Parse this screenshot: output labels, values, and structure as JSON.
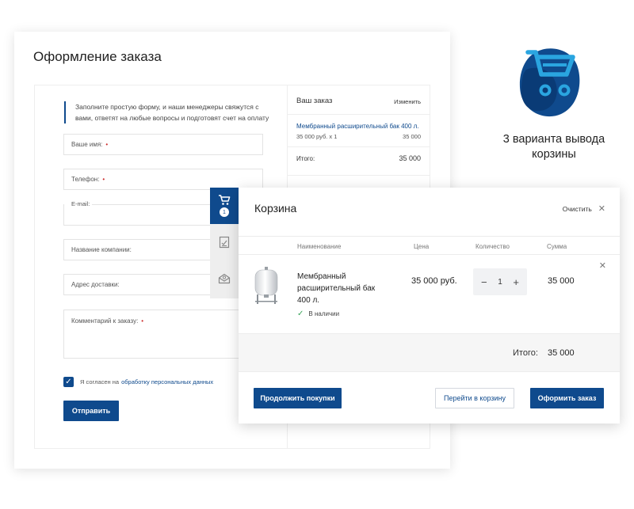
{
  "colors": {
    "brand": "#0f4a8d",
    "accent": "#2aa5e0",
    "required": "#cc2b2b",
    "success": "#3aa55a"
  },
  "order": {
    "title": "Оформление заказа",
    "intro": "Заполните простую форму, и наши менеджеры свяжутся с вами, ответят на любые вопросы и подготовят счет на оплату",
    "fields": {
      "name": "Ваше имя:",
      "phone": "Телефон:",
      "email": "E-mail:",
      "company": "Название компании:",
      "address": "Адрес доставки:",
      "comment": "Комментарий к заказу:"
    },
    "required_mark": "•",
    "agree_text": "Я согласен на",
    "agree_link": "обработку персональных данных",
    "submit": "Отправить"
  },
  "summary": {
    "title": "Ваш заказ",
    "edit": "Изменить",
    "item_name": "Мембранный расширительный бак 400 л.",
    "item_qty": "35 000 руб. x 1",
    "item_sum": "35 000",
    "total_label": "Итого:",
    "total_value": "35 000"
  },
  "side_tabs": [
    {
      "icon": "cart-icon",
      "badge": "1",
      "active": true
    },
    {
      "icon": "checklist-icon",
      "active": false
    },
    {
      "icon": "mail-icon",
      "active": false
    }
  ],
  "cart": {
    "title": "Корзина",
    "clear": "Очистить",
    "columns": {
      "name": "Наименование",
      "price": "Цена",
      "qty": "Количество",
      "sum": "Сумма"
    },
    "item": {
      "name": "Мембранный расширительный бак 400 л.",
      "stock": "В наличии",
      "price": "35 000 руб.",
      "qty": "1",
      "sum": "35 000"
    },
    "total_label": "Итого:",
    "total_value": "35 000",
    "continue": "Продолжить покупки",
    "goto_cart": "Перейти в корзину",
    "checkout": "Оформить заказ"
  },
  "promo": {
    "text": "3 варианта вывода корзины"
  }
}
